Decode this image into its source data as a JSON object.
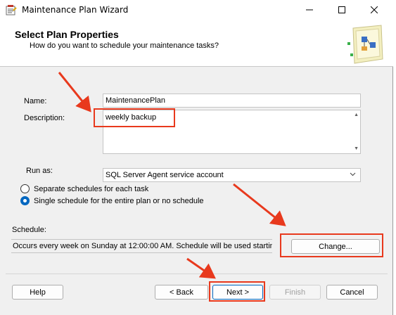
{
  "window": {
    "title": "Maintenance Plan Wizard",
    "controls": {
      "minimize": "minimize-icon",
      "maximize": "maximize-icon",
      "close": "close-icon"
    }
  },
  "header": {
    "title": "Select Plan Properties",
    "subtitle": "How do you want to schedule your maintenance tasks?",
    "icon": "wizard-diagram-icon"
  },
  "form": {
    "name_label": "Name:",
    "name_value": "MaintenancePlan",
    "description_label": "Description:",
    "description_value": "weekly backup",
    "run_as_label": "Run as:",
    "run_as_value": "SQL Server Agent service account",
    "options": [
      {
        "label": "Separate schedules for each task",
        "selected": false
      },
      {
        "label": "Single schedule for the entire plan or no schedule",
        "selected": true
      }
    ],
    "schedule_label": "Schedule:",
    "schedule_value": "Occurs every week on Sunday at 12:00:00 AM. Schedule will be used starting",
    "change_button": "Change..."
  },
  "footer": {
    "help": "Help",
    "back": "< Back",
    "next": "Next >",
    "finish": "Finish",
    "cancel": "Cancel"
  },
  "annotation_color": "#e8391d"
}
